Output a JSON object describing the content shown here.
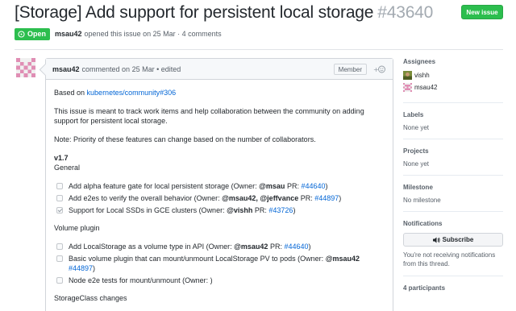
{
  "issue": {
    "title": "[Storage] Add support for persistent local storage",
    "number": "#43640",
    "state": "Open",
    "author": "msau42",
    "opened_text": "opened this issue on 25 Mar · 4 comments"
  },
  "header": {
    "new_issue_label": "New issue"
  },
  "comment": {
    "author": "msau42",
    "meta": "commented on 25 Mar • edited",
    "badge": "Member",
    "reaction_label": "+☺",
    "based_on_prefix": "Based on",
    "based_on_link": "kubernetes/community#306",
    "p1": "This issue is meant to track work items and help collaboration between the community on adding support for persistent local storage.",
    "p2": "Note: Priority of these features can change based on the number of collaborators.",
    "version": "v1.7",
    "general": "General",
    "tasks_general": [
      {
        "checked": false,
        "pre": "Add alpha feature gate for local persistent storage (Owner: ",
        "owner": "@msau",
        "mid": " PR: ",
        "link": "#44640",
        "post": ")"
      },
      {
        "checked": false,
        "pre": "Add e2es to verify the overall behavior (Owner: ",
        "owner": "@msau42, @jeffvance",
        "mid": " PR: ",
        "link": "#44897",
        "post": ")"
      },
      {
        "checked": true,
        "pre": "Support for Local SSDs in GCE clusters (Owner: ",
        "owner": "@vishh",
        "mid": " PR: ",
        "link": "#43726",
        "post": ")"
      }
    ],
    "volume_plugin": "Volume plugin",
    "tasks_volume": [
      {
        "checked": false,
        "pre": "Add LocalStorage as a volume type in API (Owner: ",
        "owner": "@msau42",
        "mid": " PR: ",
        "link": "#44640",
        "post": ")"
      },
      {
        "checked": false,
        "pre": "Basic volume plugin that can mount/unmount LocalStorage PV to pods (Owner: ",
        "owner": "@msau42",
        "mid": " ",
        "link": "#44897",
        "post": ")"
      },
      {
        "checked": false,
        "pre": "Node e2e tests for mount/unmount (Owner: )",
        "owner": "",
        "mid": "",
        "link": "",
        "post": ""
      }
    ],
    "storageclass": "StorageClass changes"
  },
  "sidebar": {
    "assignees_label": "Assignees",
    "assignees": [
      "vishh",
      "msau42"
    ],
    "labels_label": "Labels",
    "labels_value": "None yet",
    "projects_label": "Projects",
    "projects_value": "None yet",
    "milestone_label": "Milestone",
    "milestone_value": "No milestone",
    "notifications_label": "Notifications",
    "subscribe_label": "Subscribe",
    "notification_note": "You're not receiving notifications from this thread.",
    "participants": "4 participants"
  },
  "colors": {
    "open_green": "#2cbe4e",
    "link_blue": "#0366d6",
    "identicon_pink": "#e08eb4"
  }
}
